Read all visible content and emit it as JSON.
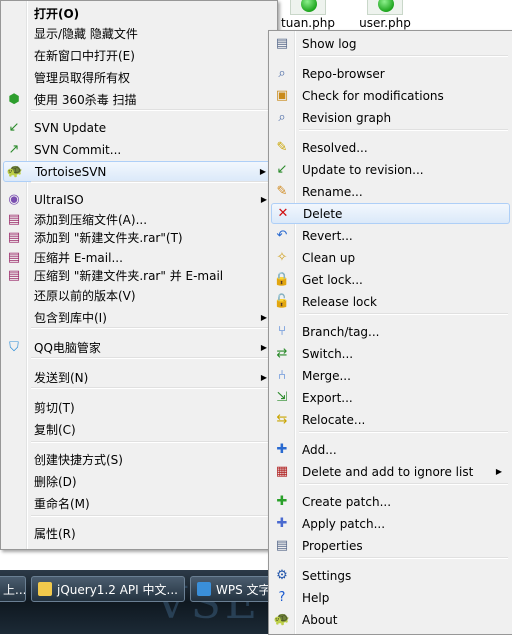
{
  "desktop": {
    "files": [
      {
        "name": "tuan.php"
      },
      {
        "name": "user.php"
      }
    ]
  },
  "taskbar": {
    "buttons": [
      {
        "label": "上..."
      },
      {
        "label": "jQuery1.2 API 中文..."
      },
      {
        "label": "WPS 文字"
      }
    ],
    "watermark": "VSEVE"
  },
  "context_menu": {
    "items": [
      {
        "label": "打开(O)",
        "bold": true
      },
      {
        "label": "显示/隐藏 隐藏文件"
      },
      {
        "label": "在新窗口中打开(E)"
      },
      {
        "label": "管理员取得所有权"
      },
      {
        "label": "使用 360杀毒 扫描",
        "icon": "360-shield-icon"
      },
      {
        "label": "SVN Update",
        "icon": "svn-update-icon"
      },
      {
        "label": "SVN Commit...",
        "icon": "svn-commit-icon"
      },
      {
        "label": "TortoiseSVN",
        "icon": "tortoise-icon",
        "submenu": true,
        "highlighted": true
      },
      {
        "label": "UltraISO",
        "icon": "ultraiso-icon",
        "submenu": true
      },
      {
        "label": "添加到压缩文件(A)...",
        "icon": "winrar-icon"
      },
      {
        "label": "添加到 \"新建文件夹.rar\"(T)",
        "icon": "winrar-icon"
      },
      {
        "label": "压缩并 E-mail...",
        "icon": "winrar-icon"
      },
      {
        "label": "压缩到 \"新建文件夹.rar\" 并 E-mail",
        "icon": "winrar-icon"
      },
      {
        "label": "还原以前的版本(V)"
      },
      {
        "label": "包含到库中(I)",
        "submenu": true
      },
      {
        "label": "QQ电脑管家",
        "icon": "qq-guard-icon",
        "submenu": true
      },
      {
        "label": "发送到(N)",
        "submenu": true
      },
      {
        "label": "剪切(T)"
      },
      {
        "label": "复制(C)"
      },
      {
        "label": "创建快捷方式(S)"
      },
      {
        "label": "删除(D)"
      },
      {
        "label": "重命名(M)"
      },
      {
        "label": "属性(R)"
      }
    ]
  },
  "svn_menu": {
    "items": [
      {
        "label": "Show log",
        "icon": "show-log-icon"
      },
      {
        "label": "Repo-browser",
        "icon": "repo-browser-icon"
      },
      {
        "label": "Check for modifications",
        "icon": "check-modifications-icon"
      },
      {
        "label": "Revision graph",
        "icon": "revision-graph-icon"
      },
      {
        "label": "Resolved...",
        "icon": "resolved-icon"
      },
      {
        "label": "Update to revision...",
        "icon": "update-revision-icon"
      },
      {
        "label": "Rename...",
        "icon": "rename-icon"
      },
      {
        "label": "Delete",
        "icon": "delete-icon",
        "highlighted": true
      },
      {
        "label": "Revert...",
        "icon": "revert-icon"
      },
      {
        "label": "Clean up",
        "icon": "cleanup-icon"
      },
      {
        "label": "Get lock...",
        "icon": "lock-icon"
      },
      {
        "label": "Release lock",
        "icon": "unlock-icon"
      },
      {
        "label": "Branch/tag...",
        "icon": "branch-icon"
      },
      {
        "label": "Switch...",
        "icon": "switch-icon"
      },
      {
        "label": "Merge...",
        "icon": "merge-icon"
      },
      {
        "label": "Export...",
        "icon": "export-icon"
      },
      {
        "label": "Relocate...",
        "icon": "relocate-icon"
      },
      {
        "label": "Add...",
        "icon": "add-icon"
      },
      {
        "label": "Delete and add to ignore list",
        "icon": "ignore-icon",
        "submenu": true
      },
      {
        "label": "Create patch...",
        "icon": "create-patch-icon"
      },
      {
        "label": "Apply patch...",
        "icon": "apply-patch-icon"
      },
      {
        "label": "Properties",
        "icon": "properties-icon"
      },
      {
        "label": "Settings",
        "icon": "settings-icon"
      },
      {
        "label": "Help",
        "icon": "help-icon"
      },
      {
        "label": "About",
        "icon": "about-icon"
      }
    ]
  },
  "colors": {
    "menu_bg": "#f0f0f0",
    "highlight_border": "#aecff7",
    "taskbar": "#0f1820"
  }
}
